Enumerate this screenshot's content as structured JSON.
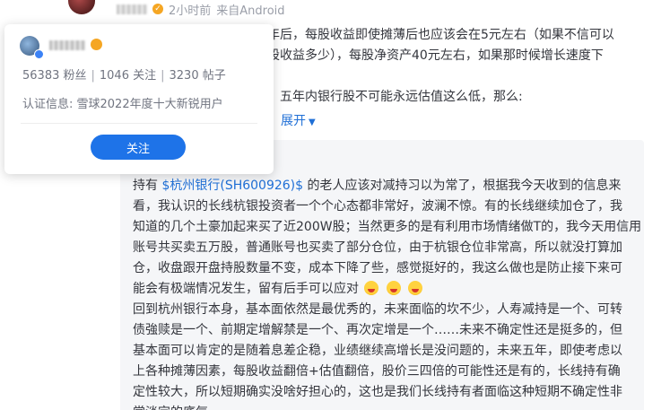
{
  "author": {
    "time": "2小时前",
    "source": "来自Android"
  },
  "post": {
    "lines": [
      "年后，每股收益即使摊薄后也应该会在5元左右（如果不信可以",
      "股收益多少），每股净资产40元左右，如果那时候增长速度下",
      "；",
      "，五年内银行股不可能永远估值这么低，那么:"
    ],
    "expand_label": "展开"
  },
  "quote": {
    "line1_prefix": "持有 ",
    "stock_link": "$杭州银行(SH600926)$",
    "line1_suffix": " 的老人应该对减持习以为常了，根据我今天收到的信息来",
    "lines": [
      "看，我认识的长线杭银投资者一个个心态都非常好，波澜不惊。有的长线继续加仓了，我",
      "知道的几个土豪加起来买了近200W股；当然更多的是有利用市场情绪做T的，我今天用信用",
      "账号共买卖五万股，普通账号也买卖了部分仓位，由于杭银仓位非常高，所以就没打算加",
      "仓，收盘跟开盘持股数量不变，成本下降了些，感觉挺好的，我这么做也是防止接下来可"
    ],
    "line6": "能会有极端情况发生，留有后手可以应对",
    "lines_b": [
      "回到杭州银行本身，基本面依然是最优秀的，未来面临的坎不少，人寿减持是一个、可转",
      "债強赎是一个、前期定增解禁是一个、再次定增是一个……未来不确定性还是挺多的，但",
      "基本面可以肯定的是随着息差企稳，业绩继续高增长是没问题的，未来五年，即使考虑以",
      "上各种摊薄因素，每股收益翻倍+估值翻倍，股价三四倍的可能性还是有的，长线持有确",
      "定性较大，所以短期确实没啥好担心的，这也是我们长线持有者面临这种短期不确定性非",
      "常淡定的底气。"
    ]
  },
  "user_card": {
    "followers": "56383 粉丝",
    "following": "1046 关注",
    "posts": "3230 帖子",
    "separator": "|",
    "certification": "认证信息: 雪球2022年度十大新锐用户",
    "follow_label": "关注"
  },
  "colors": {
    "link": "#1f6fd6",
    "follow_button": "#1e73e8",
    "quote_bg": "#f5f6f8"
  }
}
